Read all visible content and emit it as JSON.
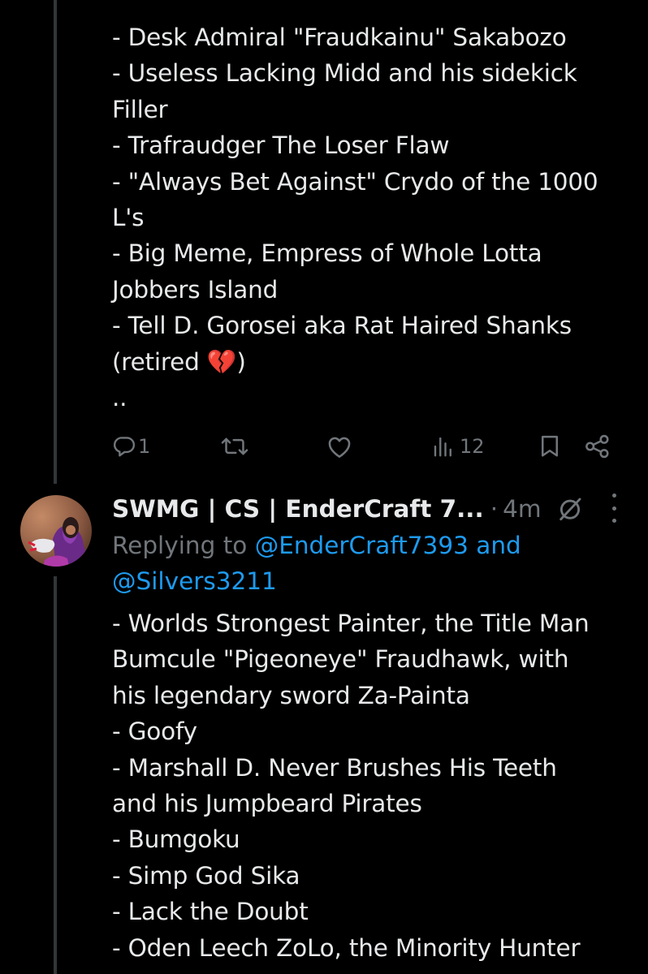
{
  "first_tweet": {
    "lines": [
      "- Desk Admiral \"Fraudkainu\" Sakabozo",
      "- Useless Lacking Midd and his sidekick",
      "Filler",
      "- Trafraudger The Loser Flaw",
      "- \"Always Bet Against\" Crydo of the 1000",
      "L's",
      "- Big Meme, Empress of Whole Lotta",
      "Jobbers Island",
      "- Tell D. Gorosei aka Rat Haired Shanks",
      "(retired 💔)",
      ".."
    ],
    "actions": {
      "reply_count": "1",
      "retweet_count": "",
      "like_count": "",
      "views_count": "12"
    }
  },
  "second_tweet": {
    "display_name": "SWMG | CS | EnderCraft 7...",
    "separator": "·",
    "timestamp": "4m",
    "replying_prefix": "Replying to ",
    "replying_mention_1": "@EnderCraft7393",
    "replying_and": " and",
    "replying_mention_2": "@Silvers3211",
    "lines": [
      "- Worlds Strongest Painter, the Title Man",
      "Bumcule \"Pigeoneye\" Fraudhawk, with",
      "his legendary sword Za-Painta",
      "- Goofy",
      "- Marshall D. Never Brushes His Teeth",
      "and his Jumpbeard Pirates",
      "- Bumgoku",
      "- Simp God Sika",
      "- Lack the Doubt",
      "- Oden Leech ZoLo, the Minority Hunter"
    ]
  },
  "colors": {
    "background": "#000000",
    "text_primary": "#e7e9ea",
    "text_secondary": "#71767b",
    "link": "#1d9bf0",
    "thread_line": "#333639"
  }
}
